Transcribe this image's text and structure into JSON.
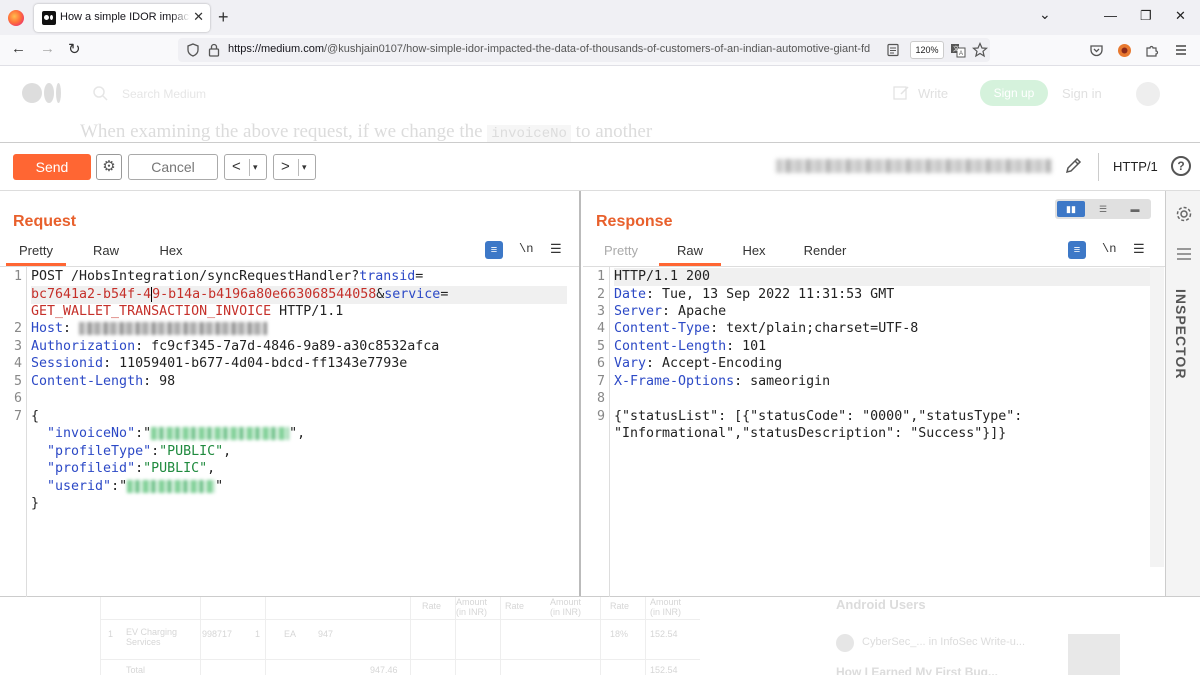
{
  "browser": {
    "tab_title": "How a simple IDOR impacted the data of thousands of customers",
    "tab_close": "✕",
    "new_tab": "+",
    "url_host": "https://medium.com",
    "url_rest": "/@kushjain0107/how-simple-idor-impacted-the-data-of-thousands-of-customers-of-an-indian-automotive-giant-fd",
    "zoom": "120%",
    "nav_back": "←",
    "nav_forward": "→",
    "nav_reload": "↻",
    "win_menu": "⌄",
    "win_min": "—",
    "win_restore": "❐",
    "win_close": "✕"
  },
  "medium": {
    "search_placeholder": "Search Medium",
    "write": "Write",
    "signup": "Sign up",
    "signin": "Sign in",
    "headline_before": "When examining the above request, if we change the ",
    "headline_code": "invoiceNo",
    "headline_after": " to another",
    "table": {
      "headers": [
        "Rate",
        "Amount (in INR)",
        "Rate",
        "Amount (in INR)",
        "Rate",
        "Amount (in INR)"
      ],
      "row1": [
        "1",
        "EV Charging Services",
        "998717",
        "1",
        "EA",
        "947",
        "18%",
        "152.54"
      ],
      "row2": [
        "Total",
        "947.46",
        "152.54"
      ]
    },
    "sidebar": {
      "title": "Android Users",
      "author": "CyberSec_...   in InfoSec Write-u...",
      "post_title": "How I Earned My First Bug..."
    }
  },
  "burp": {
    "send_label": "Send",
    "cancel_label": "Cancel",
    "back_label": "<",
    "forward_label": ">",
    "dropdown_glyph": "▾",
    "http_version": "HTTP/1",
    "help_label": "?",
    "inspector_label": "INSPECTOR",
    "request": {
      "title": "Request",
      "tabs": [
        "Pretty",
        "Raw",
        "Hex"
      ],
      "icon_newline": "\\n",
      "lines": {
        "l1_a": "POST /HobsIntegration/syncRequestHandler?",
        "l1_b": "transid",
        "l1_c": "=",
        "l1w2_a": "bc7641a2-b54f-4",
        "l1w2_b": "9-b14a-b4196a80e663068544058",
        "l1w2_c": "&",
        "l1w2_d": "service",
        "l1w2_e": "=",
        "l1w3_a": "GET_WALLET_TRANSACTION_INVOICE",
        "l1w3_b": " HTTP/1.1",
        "l2_key": "Host",
        "l2_sep": ": ",
        "l3_key": "Authorization",
        "l3_val": ": fc9cf345-7a7d-4846-9a89-a30c8532afca",
        "l4_key": "Sessionid",
        "l4_val": ": 11059401-b677-4d04-bdcd-ff1343e7793e",
        "l5_key": "Content-Length",
        "l5_val": ": 98",
        "l7": "{",
        "l7a_key": "  \"invoiceNo\"",
        "l7a_sep": ":\"",
        "l7a_end": "\",",
        "l7b_key": "  \"profileType\"",
        "l7b_sep": ":",
        "l7b_val": "\"PUBLIC\"",
        "l7b_end": ",",
        "l7c_key": "  \"profileid\"",
        "l7c_sep": ":",
        "l7c_val": "\"PUBLIC\"",
        "l7c_end": ",",
        "l7d_key": "  \"userid\"",
        "l7d_sep": ":\"",
        "l7d_end": "\"",
        "l8": "}"
      },
      "line_numbers": [
        "1",
        "2",
        "3",
        "4",
        "5",
        "6",
        "7",
        "8"
      ]
    },
    "response": {
      "title": "Response",
      "tabs": [
        "Pretty",
        "Raw",
        "Hex",
        "Render"
      ],
      "icon_newline": "\\n",
      "lines": [
        {
          "key": "HTTP/1.1 200",
          "val": ""
        },
        {
          "key": "Date",
          "val": ": Tue, 13 Sep 2022 11:31:53 GMT"
        },
        {
          "key": "Server",
          "val": ": Apache"
        },
        {
          "key": "Content-Type",
          "val": ": text/plain;charset=UTF-8"
        },
        {
          "key": "Content-Length",
          "val": ": 101"
        },
        {
          "key": "Vary",
          "val": ": Accept-Encoding"
        },
        {
          "key": "X-Frame-Options",
          "val": ": sameorigin"
        },
        {
          "key": "",
          "val": ""
        },
        {
          "key": "",
          "val": "{\"statusList\": [{\"statusCode\": \"0000\",\"statusType\":"
        },
        {
          "key": "",
          "val": "\"Informational\",\"statusDescription\": \"Success\"}]}"
        }
      ],
      "line_numbers": [
        "1",
        "2",
        "3",
        "4",
        "5",
        "6",
        "7",
        "8",
        "9"
      ]
    }
  },
  "colors": {
    "accent": "#ff6633",
    "title_orange": "#e8602c",
    "key_blue": "#2c49c6",
    "value_red": "#c5302a",
    "string_green": "#1f8a3e",
    "toggle_blue": "#3d78c7"
  }
}
